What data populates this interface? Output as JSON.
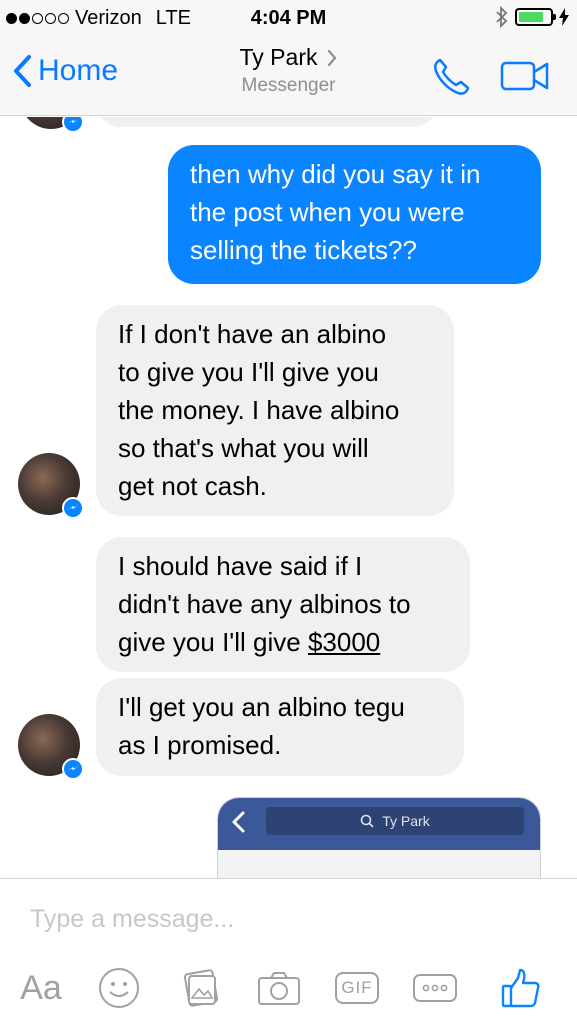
{
  "status_bar": {
    "carrier": "Verizon",
    "network": "LTE",
    "time": "4:04 PM",
    "signal_bars_filled": 2,
    "signal_bars_total": 5,
    "battery_level": 0.8
  },
  "nav": {
    "back_label": "Home",
    "contact_name": "Ty Park",
    "subtitle": "Messenger"
  },
  "messages": [
    {
      "direction": "outgoing",
      "text": [
        "then why did you say it in",
        "the post when you were",
        "selling the tickets??"
      ]
    },
    {
      "direction": "incoming",
      "text": [
        "If I don't have an albino",
        "to give you I'll give you",
        "the money. I have albino",
        "so that's what you will",
        "get not cash."
      ]
    },
    {
      "direction": "incoming",
      "text_lines": [
        "I should have said if I",
        "didn't have any albinos to"
      ],
      "last_line_prefix": "give you I'll give ",
      "last_line_link": "$3000"
    },
    {
      "direction": "incoming",
      "text": [
        "I'll get you an albino tegu",
        "as I promised."
      ]
    }
  ],
  "link_preview": {
    "search_text": "Ty Park"
  },
  "composer": {
    "placeholder": "Type a message...",
    "aa_label": "Aa",
    "gif_label": "GIF"
  },
  "colors": {
    "accent": "#0a84ff",
    "incoming_bubble": "#f0f0f0",
    "facebook_blue": "#3b5998"
  }
}
